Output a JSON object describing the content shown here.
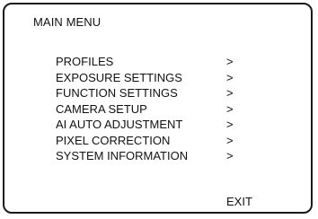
{
  "menu": {
    "title": "MAIN MENU",
    "items": [
      {
        "label": "PROFILES",
        "arrow": ">"
      },
      {
        "label": "EXPOSURE SETTINGS",
        "arrow": ">"
      },
      {
        "label": "FUNCTION SETTINGS",
        "arrow": ">"
      },
      {
        "label": "CAMERA SETUP",
        "arrow": ">"
      },
      {
        "label": "AI AUTO ADJUSTMENT",
        "arrow": ">"
      },
      {
        "label": "PIXEL CORRECTION",
        "arrow": ">"
      },
      {
        "label": "SYSTEM INFORMATION",
        "arrow": ">"
      }
    ],
    "exit_label": "EXIT"
  }
}
